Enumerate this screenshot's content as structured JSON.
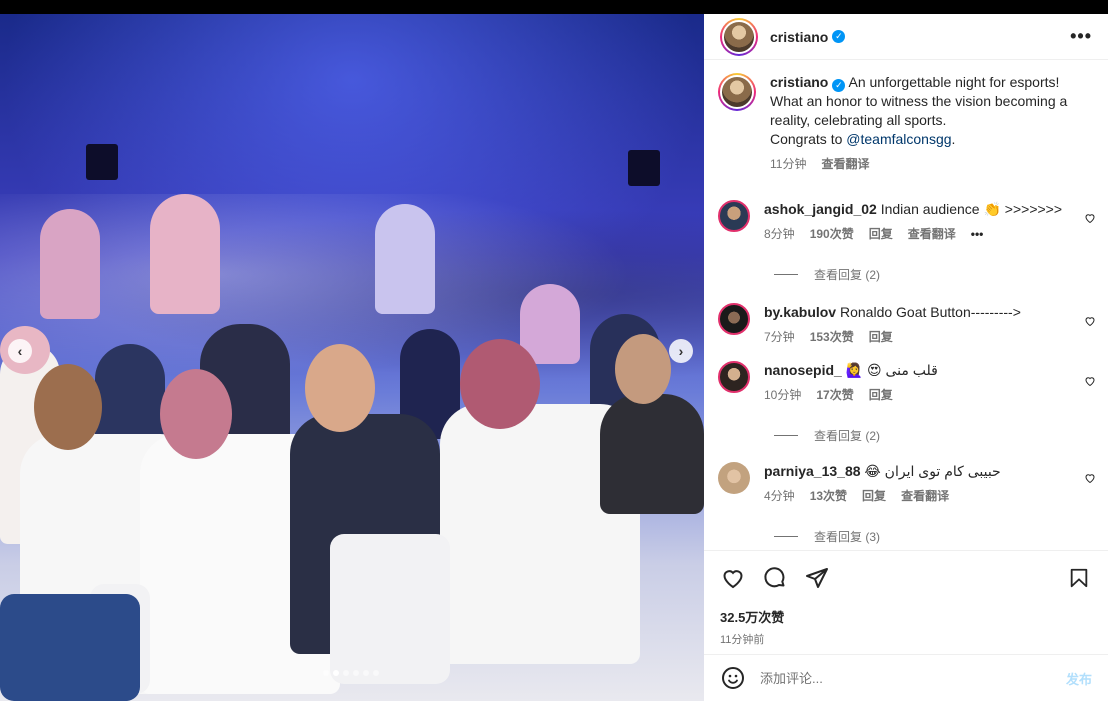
{
  "post": {
    "author": "cristiano",
    "verified_icon": "verified-badge-icon",
    "more_icon": "more-horizontal-icon",
    "caption": {
      "text": "An unforgettable night for esports! What an honor to witness the vision becoming a reality, celebrating all sports.",
      "congrats_prefix": "Congrats to ",
      "mention": "@teamfalconsgg",
      "suffix": ".",
      "time": "11分钟",
      "translate": "查看翻译"
    },
    "media": {
      "slide_count": 6,
      "active_slide": 2
    }
  },
  "comments": [
    {
      "user": "ashok_jangid_02",
      "text": "Indian audience 👏 >>>>>>>",
      "time": "8分钟",
      "likes": "190次赞",
      "reply": "回复",
      "translate": "查看翻译",
      "more": "•••",
      "view_replies": "查看回复 (2)"
    },
    {
      "user": "by.kabulov",
      "text": "Ronaldo Goat Button--------->",
      "time": "7分钟",
      "likes": "153次赞",
      "reply": "回复"
    },
    {
      "user": "nanosepid_",
      "text": "🙋‍♀️ 😍 قلب منی",
      "time": "10分钟",
      "likes": "17次赞",
      "reply": "回复",
      "view_replies": "查看回复 (2)"
    },
    {
      "user": "parniya_13_88",
      "text": "😂 حبیبی کام توی ایران",
      "time": "4分钟",
      "likes": "13次赞",
      "reply": "回复",
      "translate": "查看翻译",
      "view_replies": "查看回复 (3)"
    }
  ],
  "actions": {
    "likes": "32.5万次赞",
    "time": "11分钟前"
  },
  "comment_box": {
    "placeholder": "添加评论...",
    "post": "发布"
  },
  "colors": {
    "link": "#00376b",
    "verified": "#0095f6",
    "muted": "#737373",
    "post_disabled": "#b2dffc"
  }
}
